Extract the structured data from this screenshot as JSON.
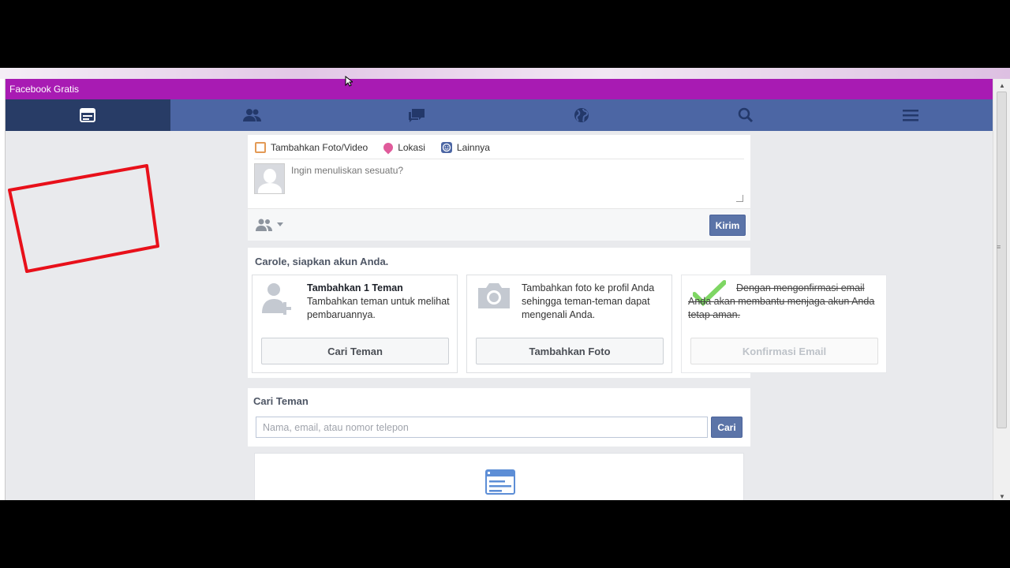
{
  "window": {
    "title": "Facebook Gratis"
  },
  "nav": {
    "items": [
      {
        "icon": "news-feed-icon",
        "active": true
      },
      {
        "icon": "friends-icon",
        "active": false
      },
      {
        "icon": "messages-icon",
        "active": false
      },
      {
        "icon": "globe-icon",
        "active": false
      },
      {
        "icon": "search-icon",
        "active": false
      },
      {
        "icon": "menu-icon",
        "active": false
      }
    ]
  },
  "composer": {
    "actions": [
      {
        "label": "Tambahkan Foto/Video",
        "icon": "photo-icon"
      },
      {
        "label": "Lokasi",
        "icon": "location-icon"
      },
      {
        "label": "Lainnya",
        "icon": "smiley-icon"
      }
    ],
    "placeholder": "Ingin menuliskan sesuatu?",
    "send_label": "Kirim"
  },
  "setup": {
    "title": "Carole, siapkan akun Anda.",
    "cards": [
      {
        "heading": "Tambahkan 1 Teman",
        "text": "Tambahkan teman untuk melihat pembaruannya.",
        "button": "Cari Teman"
      },
      {
        "text": "Tambahkan foto ke profil Anda sehingga teman-teman dapat mengenali Anda.",
        "button": "Tambahkan Foto"
      },
      {
        "text": "Dengan mengonfirmasi email Anda akan membantu menjaga akun Anda tetap aman.",
        "button": "Konfirmasi Email",
        "completed": true
      }
    ]
  },
  "find_friends": {
    "title": "Cari Teman",
    "placeholder": "Nama, email, atau nomor telepon",
    "button": "Cari"
  },
  "colors": {
    "title_bar": "#a81bb3",
    "nav_bar": "#4c66a4",
    "nav_active": "#283c66",
    "annotation": "#e8101a",
    "check": "#7ed663"
  }
}
